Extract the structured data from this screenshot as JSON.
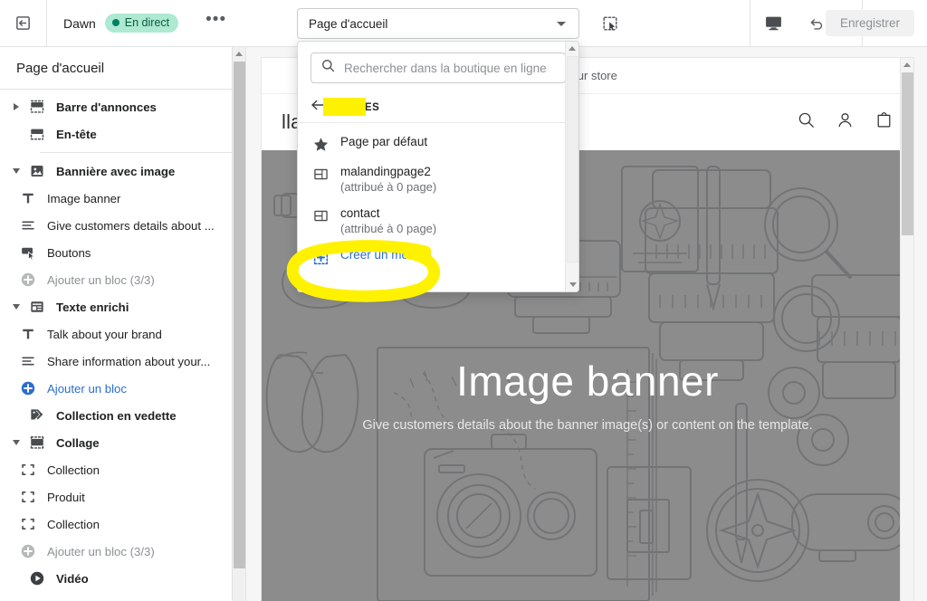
{
  "topbar": {
    "exit_icon": "exit-editor-icon",
    "theme_name": "Dawn",
    "status_badge": "En direct",
    "more_label": "•••",
    "page_selector_value": "Page d'accueil",
    "inspect_icon": "inspector-select-icon",
    "device_icon": "desktop-view-icon",
    "undo_icon": "undo-icon",
    "redo_icon": "redo-icon",
    "save_label": "Enregistrer"
  },
  "sidebar": {
    "title": "Page d'accueil",
    "items": [
      {
        "label": "Barre d'annonces",
        "icon": "announcement-bar-icon",
        "level": 0,
        "toggle": "right",
        "style": "bold"
      },
      {
        "label": "En-tête",
        "icon": "header-icon",
        "level": 0,
        "toggle": "none",
        "style": "bold"
      },
      {
        "label": "Bannière avec image",
        "icon": "image-banner-icon",
        "level": 0,
        "toggle": "down",
        "style": "bold",
        "divider_above": true
      },
      {
        "label": "Image banner",
        "icon": "heading-text-icon",
        "level": 1,
        "toggle": "none",
        "style": "normal"
      },
      {
        "label": "Give customers details about ...",
        "icon": "paragraph-icon",
        "level": 1,
        "toggle": "none",
        "style": "normal"
      },
      {
        "label": "Boutons",
        "icon": "buttons-icon",
        "level": 1,
        "toggle": "none",
        "style": "normal"
      },
      {
        "label": "Ajouter un bloc (3/3)",
        "icon": "add-block-disabled-icon",
        "level": 1,
        "toggle": "none",
        "style": "muted"
      },
      {
        "label": "Texte enrichi",
        "icon": "rich-text-icon",
        "level": 0,
        "toggle": "down",
        "style": "bold"
      },
      {
        "label": "Talk about your brand",
        "icon": "heading-text-icon",
        "level": 1,
        "toggle": "none",
        "style": "normal"
      },
      {
        "label": "Share information about your...",
        "icon": "paragraph-icon",
        "level": 1,
        "toggle": "none",
        "style": "normal"
      },
      {
        "label": "Ajouter un bloc",
        "icon": "add-block-icon",
        "level": 1,
        "toggle": "none",
        "style": "link"
      },
      {
        "label": "Collection en vedette",
        "icon": "featured-collection-icon",
        "level": 0,
        "toggle": "none",
        "style": "bold"
      },
      {
        "label": "Collage",
        "icon": "collage-icon",
        "level": 0,
        "toggle": "down",
        "style": "bold"
      },
      {
        "label": "Collection",
        "icon": "block-placeholder-icon",
        "level": 1,
        "toggle": "none",
        "style": "normal"
      },
      {
        "label": "Produit",
        "icon": "block-placeholder-icon",
        "level": 1,
        "toggle": "none",
        "style": "normal"
      },
      {
        "label": "Collection",
        "icon": "block-placeholder-icon",
        "level": 1,
        "toggle": "none",
        "style": "normal"
      },
      {
        "label": "Ajouter un bloc (3/3)",
        "icon": "add-block-disabled-icon",
        "level": 1,
        "toggle": "none",
        "style": "muted"
      },
      {
        "label": "Vidéo",
        "icon": "video-icon",
        "level": 0,
        "toggle": "none",
        "style": "bold"
      }
    ]
  },
  "dropdown": {
    "search_placeholder": "Rechercher dans la boutique en ligne",
    "search_icon": "search-icon",
    "back_icon": "back-arrow-icon",
    "back_label": "PAGES",
    "items": [
      {
        "title": "Page par défaut",
        "subtitle": "",
        "icon": "star-icon"
      },
      {
        "title": "malandingpage2",
        "subtitle": "(attribué à 0 page)",
        "icon": "template-icon"
      },
      {
        "title": "contact",
        "subtitle": "(attribué à 0 page)",
        "icon": "template-icon"
      },
      {
        "title": "Créer un modèle",
        "subtitle": "",
        "icon": "create-template-icon"
      }
    ]
  },
  "preview": {
    "announcement": "to our store",
    "store_name": "llat",
    "search_icon": "search-icon",
    "account_icon": "account-icon",
    "cart_icon": "cart-icon",
    "hero_title": "Image banner",
    "hero_subtitle": "Give customers details about the banner image(s) or content on the template."
  },
  "colors": {
    "accent_link": "#2c6ecb",
    "badge_bg": "#aee9d1",
    "badge_dot": "#008060",
    "highlight_yellow": "#fff200",
    "hero_bg": "#8c8c8c"
  }
}
